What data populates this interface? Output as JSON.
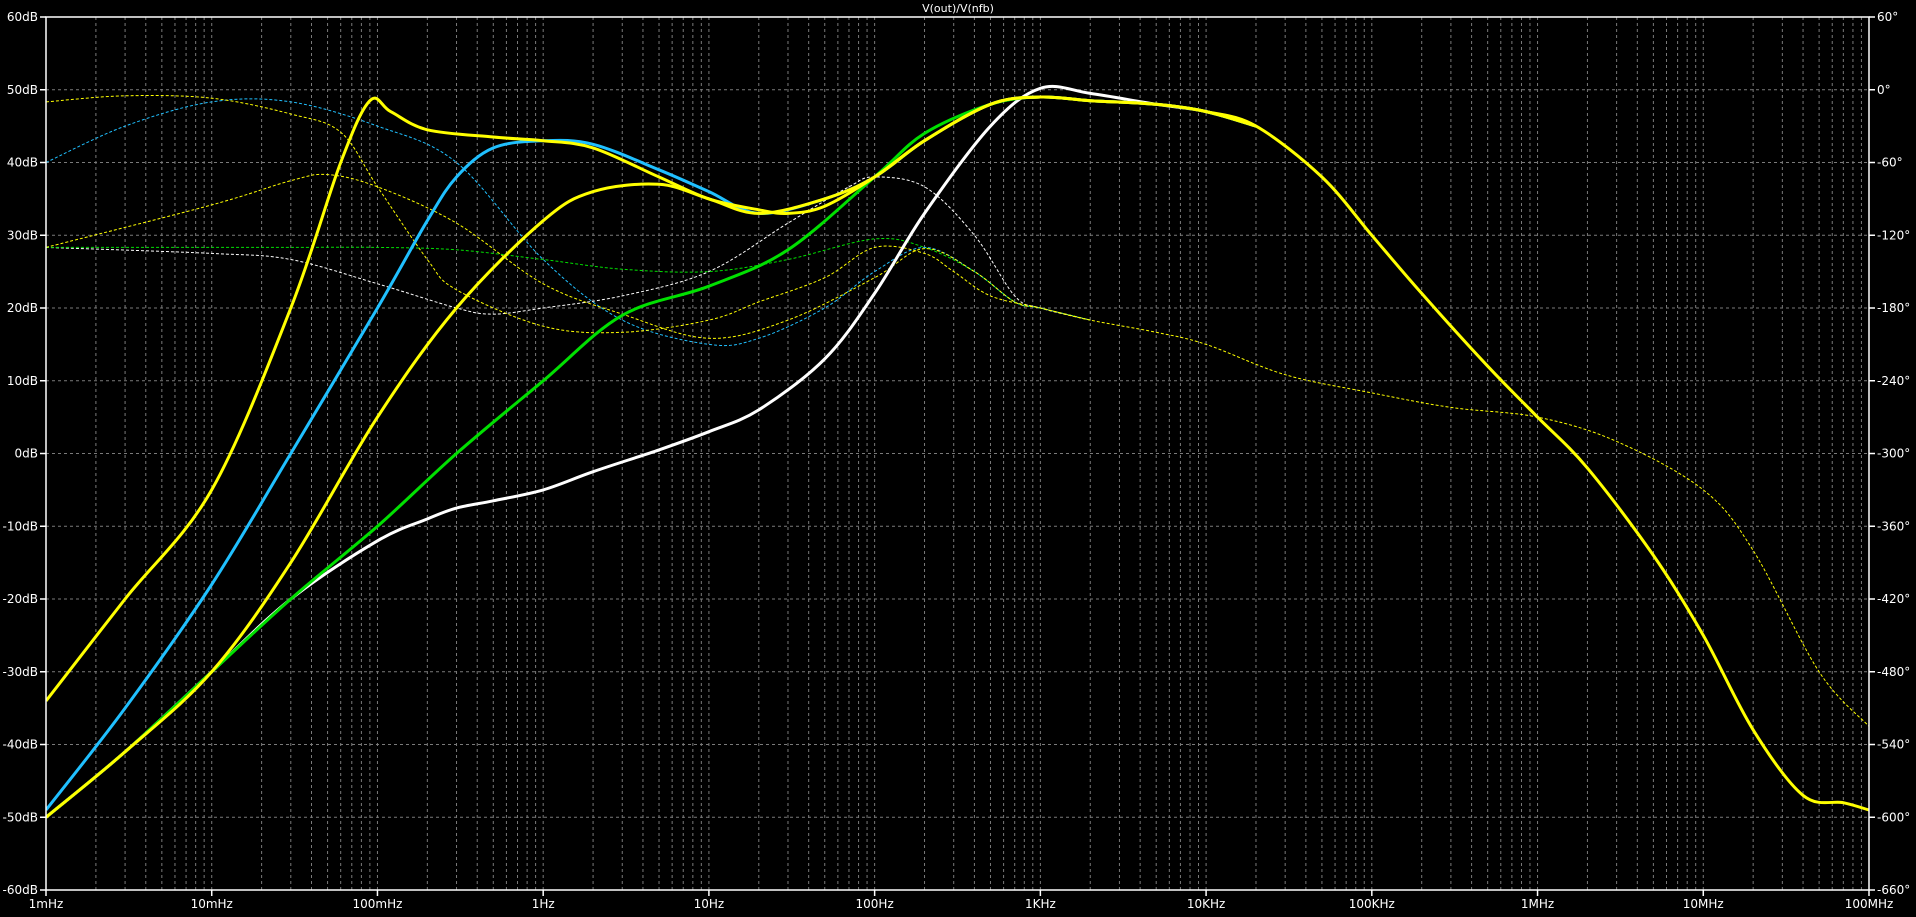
{
  "chart_data": {
    "type": "line",
    "title": "V(out)/V(nfb)",
    "x_scale": "log",
    "xlim": [
      0.001,
      100000000
    ],
    "ylim": [
      -60,
      60
    ],
    "y2lim": [
      -660,
      60
    ],
    "grid": true,
    "x_ticks": [
      {
        "value": 0.001,
        "label": "1mHz"
      },
      {
        "value": 0.01,
        "label": "10mHz"
      },
      {
        "value": 0.1,
        "label": "100mHz"
      },
      {
        "value": 1,
        "label": "1Hz"
      },
      {
        "value": 10,
        "label": "10Hz"
      },
      {
        "value": 100,
        "label": "100Hz"
      },
      {
        "value": 1000,
        "label": "1KHz"
      },
      {
        "value": 10000,
        "label": "10KHz"
      },
      {
        "value": 100000,
        "label": "100KHz"
      },
      {
        "value": 1000000,
        "label": "1MHz"
      },
      {
        "value": 10000000,
        "label": "10MHz"
      },
      {
        "value": 100000000,
        "label": "100MHz"
      }
    ],
    "y_ticks": [
      {
        "value": 60,
        "label": "60dB"
      },
      {
        "value": 50,
        "label": "50dB"
      },
      {
        "value": 40,
        "label": "40dB"
      },
      {
        "value": 30,
        "label": "30dB"
      },
      {
        "value": 20,
        "label": "20dB"
      },
      {
        "value": 10,
        "label": "10dB"
      },
      {
        "value": 0,
        "label": "0dB"
      },
      {
        "value": -10,
        "label": "-10dB"
      },
      {
        "value": -20,
        "label": "-20dB"
      },
      {
        "value": -30,
        "label": "-30dB"
      },
      {
        "value": -40,
        "label": "-40dB"
      },
      {
        "value": -50,
        "label": "-50dB"
      },
      {
        "value": -60,
        "label": "-60dB"
      }
    ],
    "y2_ticks": [
      {
        "value": 60,
        "label": "60°"
      },
      {
        "value": 0,
        "label": "0°"
      },
      {
        "value": -60,
        "label": "-60°"
      },
      {
        "value": -120,
        "label": "-120°"
      },
      {
        "value": -180,
        "label": "-180°"
      },
      {
        "value": -240,
        "label": "-240°"
      },
      {
        "value": -300,
        "label": "-300°"
      },
      {
        "value": -360,
        "label": "-360°"
      },
      {
        "value": -420,
        "label": "-420°"
      },
      {
        "value": -480,
        "label": "-480°"
      },
      {
        "value": -540,
        "label": "-540°"
      },
      {
        "value": -600,
        "label": "-600°"
      },
      {
        "value": -660,
        "label": "-660°"
      }
    ],
    "series": [
      {
        "color": "#ffffff",
        "kind": "magnitude",
        "axis": "y",
        "x": [
          0.001,
          0.003,
          0.01,
          0.03,
          0.1,
          0.2,
          0.3,
          0.5,
          1,
          2,
          5,
          10,
          20,
          50,
          100,
          200,
          500,
          1000,
          2000,
          5000,
          10000,
          20000
        ],
        "y": [
          -50,
          -41,
          -30,
          -20,
          -12,
          -9,
          -7.5,
          -6.5,
          -5,
          -2.5,
          0.5,
          3,
          6,
          13,
          22,
          33,
          45,
          50.2,
          49.5,
          48,
          47,
          45
        ]
      },
      {
        "color": "#ffffff",
        "kind": "phase",
        "axis": "y2",
        "x": [
          0.001,
          0.01,
          0.03,
          0.1,
          0.3,
          0.5,
          1,
          3,
          10,
          30,
          70,
          100,
          200,
          400,
          700,
          1000,
          2000
        ],
        "y": [
          -130,
          -135,
          -140,
          -160,
          -180,
          -185,
          -180,
          -170,
          -150,
          -110,
          -80,
          -72,
          -80,
          -120,
          -170,
          -180,
          -190
        ]
      },
      {
        "color": "#00e000",
        "kind": "magnitude",
        "axis": "y",
        "x": [
          0.001,
          0.003,
          0.01,
          0.03,
          0.1,
          0.3,
          1,
          3,
          10,
          30,
          100,
          200,
          500,
          1000,
          2000,
          5000,
          10000,
          20000
        ],
        "y": [
          -50,
          -41,
          -30,
          -20,
          -10,
          0,
          10,
          19,
          23,
          28,
          38,
          44,
          48,
          49,
          48.5,
          48,
          47,
          45
        ]
      },
      {
        "color": "#00e000",
        "kind": "phase",
        "axis": "y2",
        "x": [
          0.001,
          0.01,
          0.03,
          0.1,
          0.3,
          1,
          3,
          10,
          30,
          100,
          200,
          400,
          700,
          1000,
          2000
        ],
        "y": [
          -130,
          -130,
          -130,
          -130,
          -132,
          -140,
          -148,
          -150,
          -140,
          -123,
          -130,
          -150,
          -175,
          -180,
          -190
        ]
      },
      {
        "color": "#20c0ff",
        "kind": "magnitude",
        "axis": "y",
        "x": [
          0.001,
          0.003,
          0.01,
          0.03,
          0.1,
          0.2,
          0.3,
          0.5,
          1,
          2,
          5,
          10,
          20,
          50,
          100,
          200,
          500,
          1000,
          2000,
          5000,
          10000,
          20000
        ],
        "y": [
          -49,
          -35,
          -18,
          0,
          20,
          32,
          38,
          42,
          43,
          42.5,
          39,
          36,
          33,
          35,
          38,
          43,
          48,
          49,
          48.5,
          48,
          47,
          45
        ]
      },
      {
        "color": "#20c0ff",
        "kind": "phase",
        "axis": "y2",
        "x": [
          0.001,
          0.003,
          0.01,
          0.03,
          0.1,
          0.3,
          1,
          3,
          10,
          20,
          50,
          100,
          200,
          400,
          700,
          1000,
          2000
        ],
        "y": [
          -60,
          -30,
          -10,
          -10,
          -30,
          -60,
          -140,
          -190,
          -210,
          -205,
          -180,
          -150,
          -130,
          -150,
          -175,
          -180,
          -190
        ]
      },
      {
        "color": "#ffff00",
        "kind": "magnitude",
        "axis": "y",
        "x": [
          0.001,
          0.003,
          0.01,
          0.03,
          0.06,
          0.09,
          0.12,
          0.2,
          0.5,
          1,
          2,
          5,
          10,
          20,
          30,
          50,
          100,
          200,
          500,
          1000,
          2000,
          5000,
          10000,
          20000,
          50000,
          100000,
          200000,
          500000,
          1000000,
          2000000,
          5000000,
          10000000,
          20000000,
          40000000,
          70000000,
          100000000
        ],
        "y": [
          -34,
          -20,
          -5,
          20,
          40,
          48.5,
          47,
          44.5,
          43.5,
          43,
          42,
          38,
          35,
          33.5,
          33,
          34,
          38,
          43,
          48,
          49,
          48.5,
          48,
          47,
          45,
          38,
          30,
          22,
          12,
          5,
          -2,
          -14,
          -25,
          -38,
          -47,
          -48,
          -49
        ]
      },
      {
        "color": "#ffff00",
        "kind": "magnitude",
        "axis": "y",
        "x": [
          0.001,
          0.003,
          0.01,
          0.03,
          0.1,
          0.3,
          1,
          2,
          5,
          10,
          20,
          50,
          100,
          200,
          500,
          1000,
          2000,
          5000,
          10000,
          20000
        ],
        "y": [
          -50,
          -41,
          -30,
          -15,
          5,
          20,
          32,
          36,
          37,
          35,
          33,
          35,
          38,
          43,
          48,
          49,
          48.5,
          48,
          47,
          45
        ]
      },
      {
        "color": "#ffff00",
        "kind": "phase",
        "axis": "y2",
        "x": [
          0.001,
          0.003,
          0.01,
          0.03,
          0.06,
          0.1,
          0.2,
          0.3,
          1,
          3,
          10,
          20,
          50,
          100,
          200,
          300,
          500,
          1000,
          2000,
          5000,
          10000,
          30000,
          100000,
          300000,
          1000000,
          3000000,
          10000000,
          20000000,
          50000000,
          100000000
        ],
        "y": [
          -10,
          -5,
          -7,
          -20,
          -35,
          -80,
          -140,
          -165,
          -195,
          -200,
          -190,
          -175,
          -155,
          -130,
          -135,
          -150,
          -170,
          -180,
          -190,
          -200,
          -210,
          -235,
          -250,
          -262,
          -270,
          -290,
          -330,
          -380,
          -480,
          -525
        ]
      },
      {
        "color": "#ffff00",
        "kind": "phase",
        "axis": "y2",
        "x": [
          0.001,
          0.01,
          0.03,
          0.05,
          0.1,
          0.3,
          1,
          3,
          10,
          30,
          100,
          200,
          400,
          700,
          1000,
          2000
        ],
        "y": [
          -130,
          -95,
          -75,
          -70,
          -80,
          -110,
          -160,
          -185,
          -205,
          -190,
          -155,
          -131,
          -150,
          -175,
          -180,
          -190
        ]
      }
    ]
  }
}
